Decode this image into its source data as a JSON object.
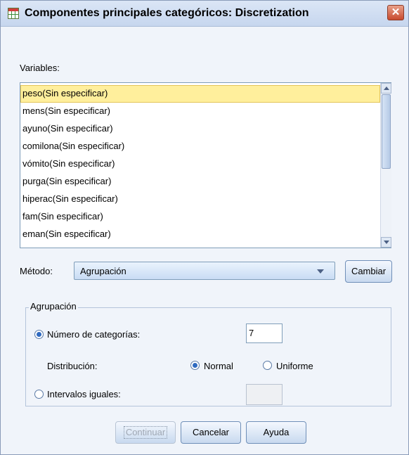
{
  "window": {
    "title": "Componentes principales categóricos: Discretization",
    "close_glyph": "✕"
  },
  "variables": {
    "label": "Variables:",
    "items": [
      "peso(Sin especificar)",
      "mens(Sin especificar)",
      "ayuno(Sin especificar)",
      "comilona(Sin especificar)",
      "vómito(Sin especificar)",
      "purga(Sin especificar)",
      "hiperac(Sin especificar)",
      "fam(Sin especificar)",
      "eman(Sin especificar)"
    ],
    "selected_index": 0
  },
  "method": {
    "label": "Método:",
    "value": "Agrupación",
    "change_button": "Cambiar"
  },
  "grouping": {
    "title": "Agrupación",
    "num_categories_label": "Número de categorías:",
    "num_categories_value": "7",
    "num_categories_selected": true,
    "distribution_label": "Distribución:",
    "normal_label": "Normal",
    "normal_selected": true,
    "uniform_label": "Uniforme",
    "uniform_selected": false,
    "equal_intervals_label": "Intervalos iguales:",
    "equal_intervals_selected": false,
    "equal_intervals_value": ""
  },
  "buttons": {
    "continue": "Continuar",
    "cancel": "Cancelar",
    "help": "Ayuda"
  },
  "colors": {
    "selection": "#ffef9c",
    "radio_dot": "#2f6ac0",
    "close": "#c84a2e"
  }
}
